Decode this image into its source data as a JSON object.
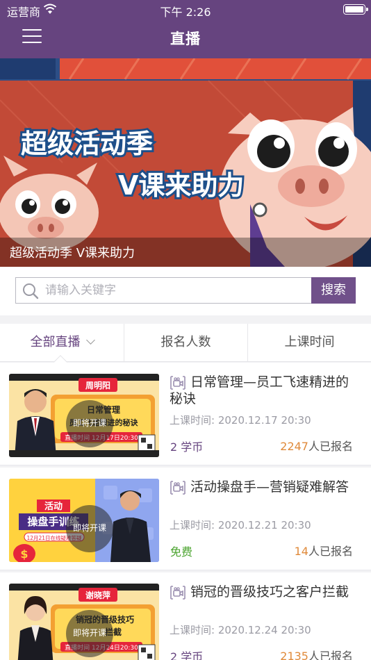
{
  "status_bar": {
    "carrier": "运营商",
    "time": "下午 2:26"
  },
  "nav": {
    "title": "直播"
  },
  "banner": {
    "headline_1": "超级活动季",
    "headline_2": "V课来助力",
    "caption": "超级活动季 V课来助力"
  },
  "search": {
    "placeholder": "请输入关键字",
    "value": "",
    "button_label": "搜索"
  },
  "tabs": [
    {
      "label": "全部直播",
      "active": true
    },
    {
      "label": "报名人数",
      "active": false
    },
    {
      "label": "上课时间",
      "active": false
    }
  ],
  "courses": [
    {
      "title": "日常管理—员工飞速精进的秘诀",
      "time_label": "上课时间: 2020.12.17 20:30",
      "price": "2 学币",
      "count": "2247",
      "count_suffix": "人已报名",
      "badge": "即将开课",
      "thumb": {
        "name": "周明阳",
        "line1": "日常管理",
        "line2": "员工飞速精进的秘诀",
        "date": "直播时间 12月17日20:30"
      }
    },
    {
      "title": "活动操盘手—营销疑难解答",
      "time_label": "上课时间: 2020.12.21 20:30",
      "price": "免费",
      "count": "14",
      "count_suffix": "人已报名",
      "badge": "即将开课",
      "thumb": {
        "line1": "活动",
        "line2": "操盘手训练",
        "date": "12月21日在线疑难答疑"
      }
    },
    {
      "title": "销冠的晋级技巧之客户拦截",
      "time_label": "上课时间: 2020.12.24 20:30",
      "price": "2 学币",
      "count": "2135",
      "count_suffix": "人已报名",
      "badge": "即将开课",
      "thumb": {
        "name": "谢晓萍",
        "line1": "销冠的晋级技巧",
        "line2": "拦截",
        "date": "直播时间 12月24日20:30"
      }
    }
  ],
  "colors": {
    "brand": "#66447f",
    "accent_orange": "#e08a3a",
    "free_green": "#4aa32e",
    "banner_red": "#c24a37"
  }
}
